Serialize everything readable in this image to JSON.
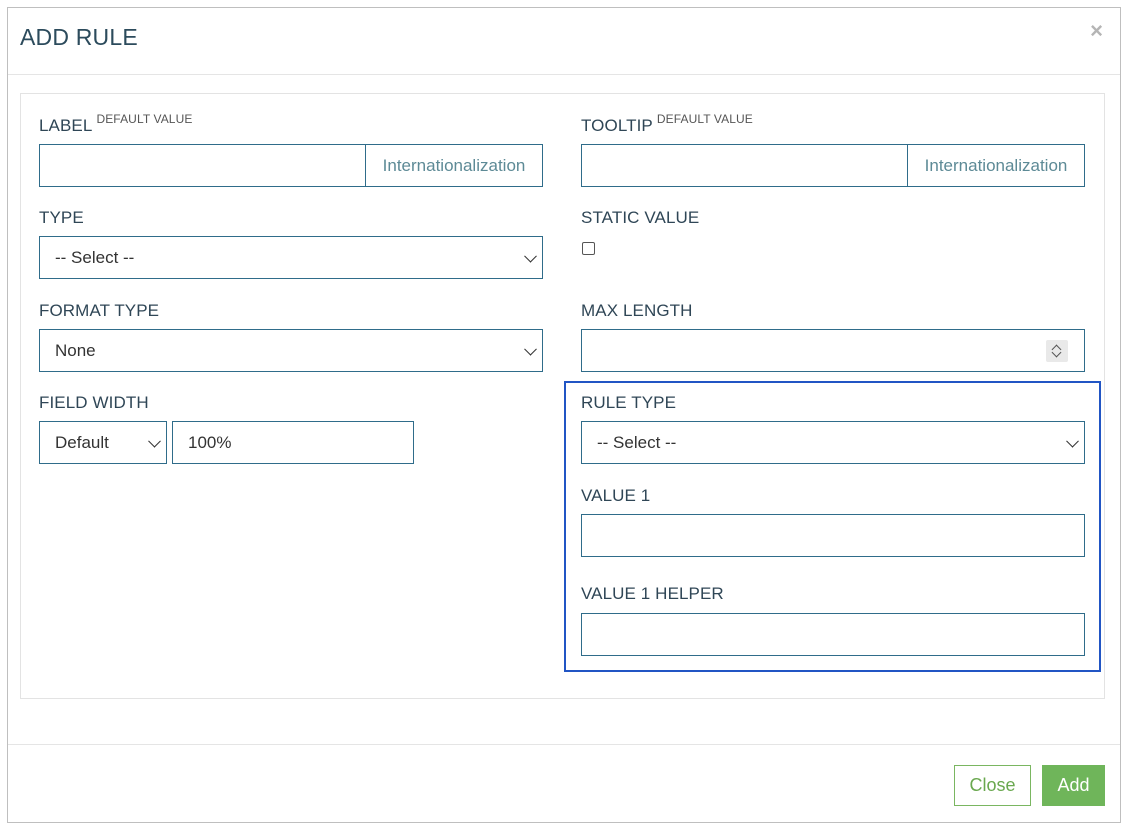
{
  "header": {
    "title": "ADD RULE",
    "close_glyph": "×"
  },
  "form": {
    "label": {
      "title": "LABEL",
      "sup": "DEFAULT VALUE",
      "value": "",
      "addon": "Internationalization"
    },
    "tooltip": {
      "title": "TOOLTIP",
      "sup": "DEFAULT VALUE",
      "value": "",
      "addon": "Internationalization"
    },
    "type": {
      "title": "TYPE",
      "selected": "-- Select --"
    },
    "static_value": {
      "title": "STATIC VALUE",
      "checked": false
    },
    "format_type": {
      "title": "FORMAT TYPE",
      "selected": "None"
    },
    "max_length": {
      "title": "MAX LENGTH",
      "value": ""
    },
    "field_width": {
      "title": "FIELD WIDTH",
      "selected": "Default",
      "value": "100%"
    },
    "rule_type": {
      "title": "RULE TYPE",
      "selected": "-- Select --"
    },
    "value1": {
      "title": "VALUE 1",
      "value": ""
    },
    "value1_helper": {
      "title": "VALUE 1 HELPER",
      "value": ""
    }
  },
  "footer": {
    "close_label": "Close",
    "add_label": "Add"
  },
  "colors": {
    "accent_green": "#6fb55a",
    "highlight_blue": "#2155c4",
    "input_border": "#2f6c8a"
  }
}
